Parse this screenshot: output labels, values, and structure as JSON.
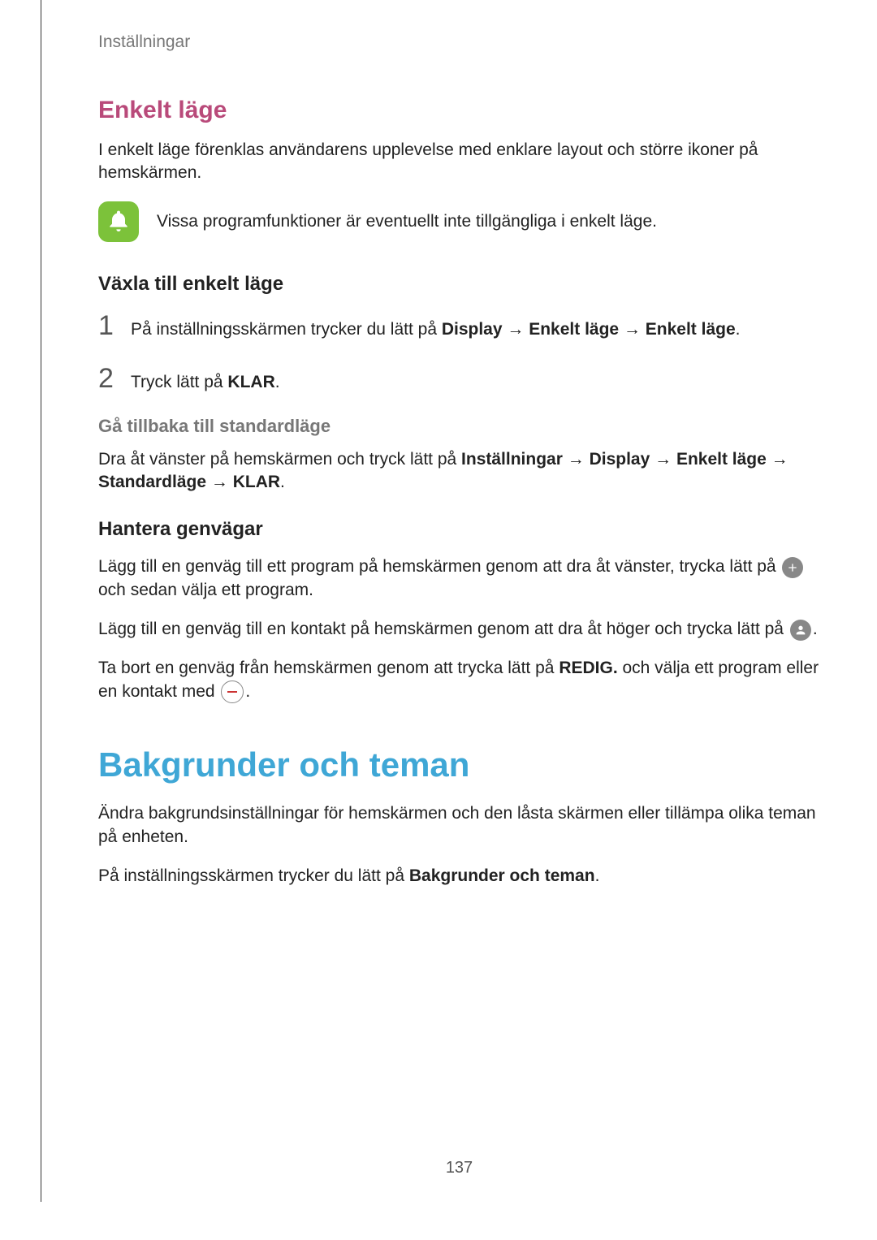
{
  "breadcrumb": "Inställningar",
  "section1": {
    "title": "Enkelt läge",
    "intro": "I enkelt läge förenklas användarens upplevelse med enklare layout och större ikoner på hemskärmen.",
    "note": "Vissa programfunktioner är eventuellt inte tillgängliga i enkelt läge."
  },
  "switch": {
    "title": "Växla till enkelt läge",
    "step1_pre": "På inställningsskärmen trycker du lätt på ",
    "step1_b1": "Display",
    "step1_arrow": " → ",
    "step1_b2": "Enkelt läge",
    "step1_b3": "Enkelt läge",
    "step1_end": ".",
    "step2_pre": "Tryck lätt på ",
    "step2_b": "KLAR",
    "step2_end": "."
  },
  "back": {
    "title": "Gå tillbaka till standardläge",
    "p_pre": "Dra åt vänster på hemskärmen och tryck lätt på ",
    "p_b1": "Inställningar",
    "arrow": " → ",
    "p_b2": "Display",
    "p_b3": "Enkelt läge",
    "p_b4": "Standardläge",
    "p_b5": "KLAR",
    "p_end": "."
  },
  "shortcuts": {
    "title": "Hantera genvägar",
    "p1_pre": "Lägg till en genväg till ett program på hemskärmen genom att dra åt vänster, trycka lätt på ",
    "p1_post": " och sedan välja ett program.",
    "p2_pre": "Lägg till en genväg till en kontakt på hemskärmen genom att dra åt höger och trycka lätt på ",
    "p2_end": ".",
    "p3_pre": "Ta bort en genväg från hemskärmen genom att trycka lätt på ",
    "p3_b": "REDIG.",
    "p3_mid": " och välja ett program eller en kontakt med ",
    "p3_end": "."
  },
  "section2": {
    "title": "Bakgrunder och teman",
    "p1": "Ändra bakgrundsinställningar för hemskärmen och den låsta skärmen eller tillämpa olika teman på enheten.",
    "p2_pre": "På inställningsskärmen trycker du lätt på ",
    "p2_b": "Bakgrunder och teman",
    "p2_end": "."
  },
  "page_number": "137"
}
